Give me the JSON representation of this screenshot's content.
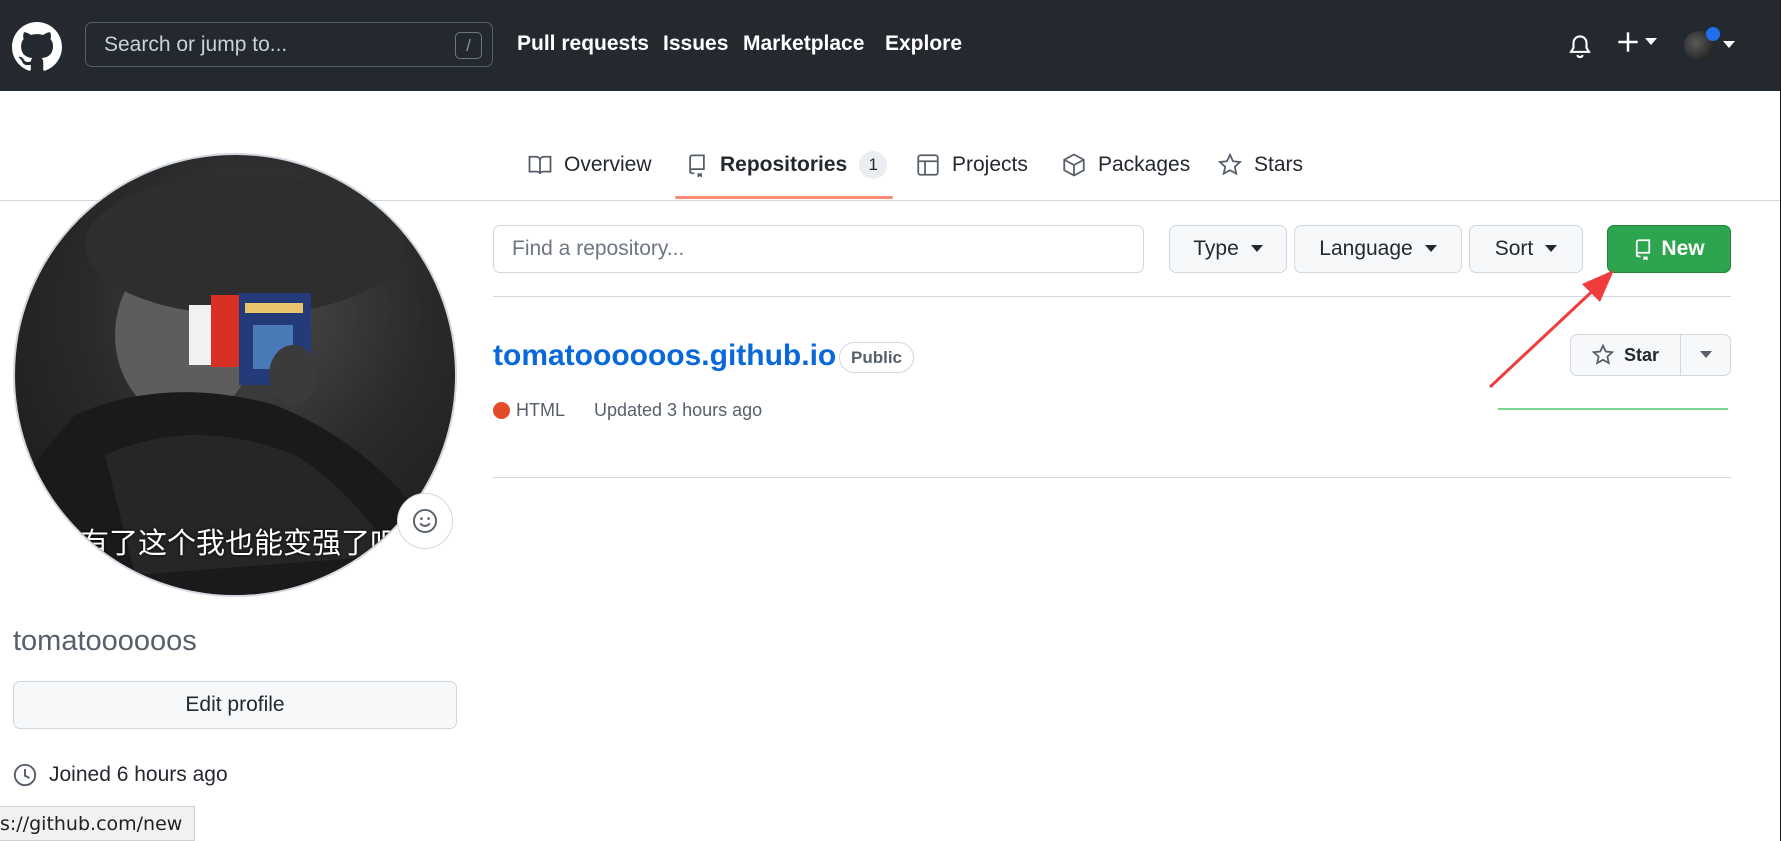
{
  "header": {
    "search_placeholder": "Search or jump to...",
    "search_shortcut": "/",
    "nav": [
      "Pull requests",
      "Issues",
      "Marketplace",
      "Explore"
    ]
  },
  "tabs": [
    {
      "label": "Overview",
      "icon": "book-icon"
    },
    {
      "label": "Repositories",
      "icon": "repo-icon",
      "count": "1",
      "active": true
    },
    {
      "label": "Projects",
      "icon": "table-icon"
    },
    {
      "label": "Packages",
      "icon": "package-icon"
    },
    {
      "label": "Stars",
      "icon": "star-icon"
    }
  ],
  "profile": {
    "photo_caption": "有了这个我也能变强了吧",
    "username": "tomatoooooos",
    "edit_label": "Edit profile",
    "joined": "Joined 6 hours ago"
  },
  "repos": {
    "find_placeholder": "Find a repository...",
    "filters": [
      "Type",
      "Language",
      "Sort"
    ],
    "new_label": "New",
    "items": [
      {
        "name": "tomatoooooos.github.io",
        "visibility": "Public",
        "language": "HTML",
        "language_color": "#e34c26",
        "updated": "Updated 3 hours ago",
        "star_label": "Star"
      }
    ]
  },
  "status_url": "s://github.com/new",
  "colors": {
    "header_bg": "#24292f",
    "accent_green": "#2da44e",
    "link_blue": "#0969da",
    "tab_underline": "#fd8c73",
    "annotation_red": "#f03c3c"
  }
}
